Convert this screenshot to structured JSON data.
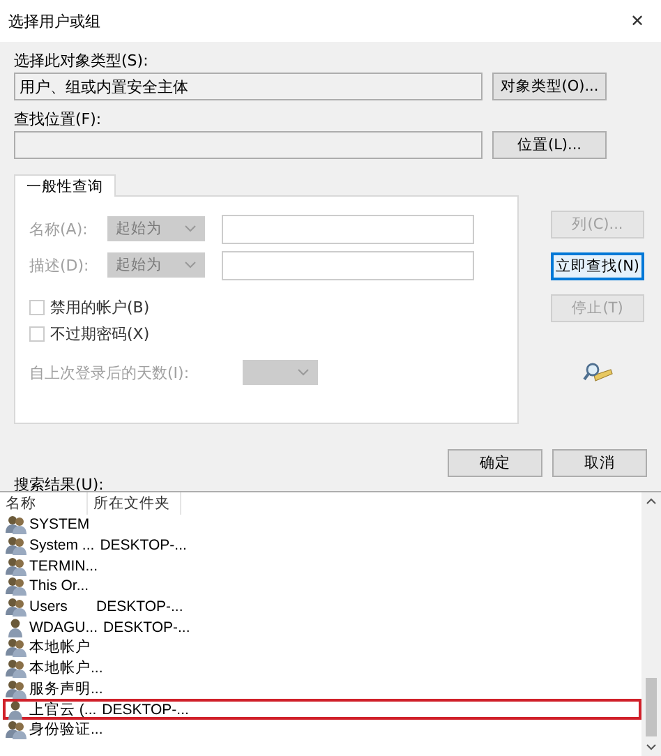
{
  "window": {
    "title": "选择用户或组",
    "close": "✕"
  },
  "object_type": {
    "label": "选择此对象类型(S):",
    "value": "用户、组或内置安全主体",
    "button": "对象类型(O)..."
  },
  "location": {
    "label": "查找位置(F):",
    "button": "位置(L)..."
  },
  "tabs": [
    {
      "label": "一般性查询",
      "selected": true
    }
  ],
  "query": {
    "fields": [
      {
        "label": "名称(A):",
        "mode": "起始为",
        "disabled": true
      },
      {
        "label": "描述(D):",
        "mode": "起始为",
        "disabled": true
      }
    ],
    "checkboxes": [
      {
        "label": "禁用的帐户(B)",
        "checked": false,
        "disabled": false
      },
      {
        "label": "不过期密码(X)",
        "checked": false,
        "disabled": false
      }
    ],
    "days": {
      "label": "自上次登录后的天数(I):",
      "disabled": true
    }
  },
  "side_buttons": [
    {
      "label": "列(C)...",
      "disabled": true,
      "focused": false
    },
    {
      "label": "立即查找(N)",
      "disabled": false,
      "focused": true
    },
    {
      "label": "停止(T)",
      "disabled": true,
      "focused": false
    }
  ],
  "ok_button": "确定",
  "cancel_button": "取消",
  "results": {
    "label": "搜索结果(U):",
    "columns": [
      "名称",
      "所在文件夹"
    ],
    "rows": [
      {
        "kind": "group",
        "name": "SYSTEM",
        "highlighted": false
      },
      {
        "kind": "group",
        "name": "System ...",
        "folder": "DESKTOP-...",
        "highlighted": false
      },
      {
        "kind": "group",
        "name": "TERMIN...",
        "highlighted": false
      },
      {
        "kind": "group",
        "name": "This Or...",
        "highlighted": false
      },
      {
        "kind": "group",
        "name": "Users",
        "folder": "DESKTOP-...",
        "highlighted": false
      },
      {
        "kind": "user",
        "name": "WDAGU...",
        "folder": "DESKTOP-...",
        "highlighted": false
      },
      {
        "kind": "group",
        "name": "本地帐户",
        "highlighted": false
      },
      {
        "kind": "group",
        "name": "本地帐户...",
        "highlighted": false
      },
      {
        "kind": "group",
        "name": "服务声明...",
        "highlighted": false
      },
      {
        "kind": "user",
        "name": "上官云 (...",
        "folder": "DESKTOP-...",
        "highlighted": true
      },
      {
        "kind": "group",
        "name": "身份验证...",
        "highlighted": false
      }
    ]
  }
}
